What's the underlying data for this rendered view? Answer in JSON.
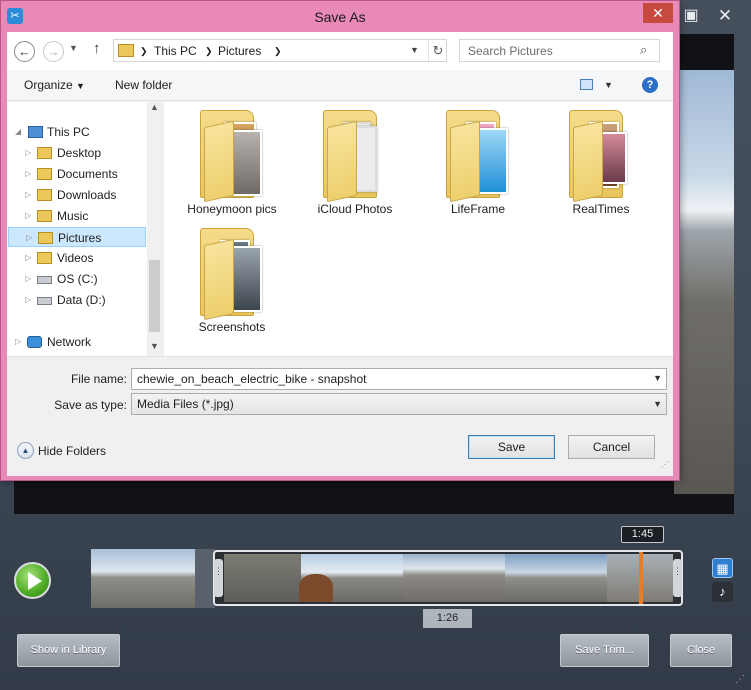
{
  "app": {
    "time_start": "1:26",
    "time_end": "1:45",
    "buttons": {
      "show_in_library": "Show in Library",
      "save_trim": "Save Trim...",
      "close": "Close"
    },
    "icons": [
      "play-icon",
      "video-mode-icon",
      "audio-mode-icon",
      "maximize-icon",
      "close-icon"
    ]
  },
  "dialog": {
    "title": "Save As",
    "breadcrumb": [
      "This PC",
      "Pictures"
    ],
    "search_placeholder": "Search Pictures",
    "toolbar": {
      "organize": "Organize",
      "new_folder": "New folder"
    },
    "tree": [
      {
        "label": "This PC",
        "icon": "pc-icon"
      },
      {
        "label": "Desktop",
        "icon": "folder-icon"
      },
      {
        "label": "Documents",
        "icon": "folder-icon"
      },
      {
        "label": "Downloads",
        "icon": "folder-icon"
      },
      {
        "label": "Music",
        "icon": "folder-icon"
      },
      {
        "label": "Pictures",
        "icon": "folder-icon",
        "selected": true
      },
      {
        "label": "Videos",
        "icon": "folder-icon"
      },
      {
        "label": "OS (C:)",
        "icon": "drive-icon"
      },
      {
        "label": "Data (D:)",
        "icon": "drive-icon"
      },
      {
        "label": "Network",
        "icon": "network-icon"
      }
    ],
    "files": [
      {
        "name": "Honeymoon pics"
      },
      {
        "name": "iCloud Photos"
      },
      {
        "name": "LifeFrame"
      },
      {
        "name": "RealTimes"
      },
      {
        "name": "Screenshots"
      }
    ],
    "file_name_label": "File name:",
    "file_name_value": "chewie_on_beach_electric_bike - snapshot",
    "save_as_type_label": "Save as type:",
    "save_as_type_value": "Media Files (*.jpg)",
    "hide_folders": "Hide Folders",
    "save_label": "Save",
    "cancel_label": "Cancel"
  },
  "colors": {
    "dialog_frame": "#e989b8",
    "close_button": "#c74a3e",
    "selection": "#cce8ff",
    "play_button": "#4caa23",
    "playhead": "#f07b1f"
  }
}
